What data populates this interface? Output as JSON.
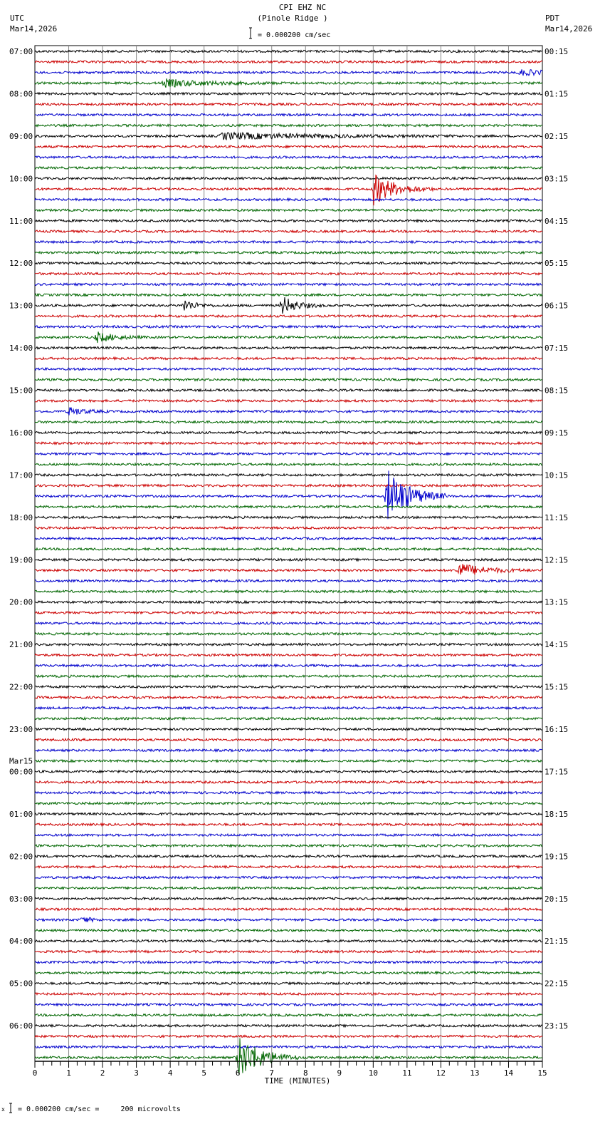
{
  "header": {
    "title": "CPI EHZ NC",
    "subtitle": "(Pinole Ridge )",
    "scale": "= 0.000200 cm/sec",
    "left_tz": "UTC",
    "left_date": "Mar14,2026",
    "right_tz": "PDT",
    "right_date": "Mar14,2026"
  },
  "footer": {
    "scale": "= 0.000200 cm/sec =     200 microvolts"
  },
  "chart_data": {
    "type": "line",
    "title": "CPI EHZ NC (Pinole Ridge )",
    "xlabel": "TIME (MINUTES)",
    "xlim": [
      0,
      15
    ],
    "xticks": [
      "0",
      "1",
      "2",
      "3",
      "4",
      "5",
      "6",
      "7",
      "8",
      "9",
      "10",
      "11",
      "12",
      "13",
      "14",
      "15"
    ],
    "traces_per_hour": 4,
    "trace_colors": [
      "#000000",
      "#cc0000",
      "#0000cc",
      "#006600"
    ],
    "left_labels": [
      "07:00",
      "08:00",
      "09:00",
      "10:00",
      "11:00",
      "12:00",
      "13:00",
      "14:00",
      "15:00",
      "16:00",
      "17:00",
      "18:00",
      "19:00",
      "20:00",
      "21:00",
      "22:00",
      "23:00",
      "00:00",
      "01:00",
      "02:00",
      "03:00",
      "04:00",
      "05:00",
      "06:00"
    ],
    "date_change": {
      "hour_index": 17,
      "label": "Mar15"
    },
    "right_labels": [
      "00:15",
      "01:15",
      "02:15",
      "03:15",
      "04:15",
      "05:15",
      "06:15",
      "07:15",
      "08:15",
      "09:15",
      "10:15",
      "11:15",
      "12:15",
      "13:15",
      "14:15",
      "15:15",
      "16:15",
      "17:15",
      "18:15",
      "19:15",
      "20:15",
      "21:15",
      "22:15",
      "23:15"
    ],
    "events": [
      {
        "trace": 3,
        "minute": 3.8,
        "amp": 0.35,
        "dur": 1.2
      },
      {
        "trace": 2,
        "minute": 14.3,
        "amp": 0.25,
        "dur": 1.0
      },
      {
        "trace": 8,
        "minute": 5.5,
        "amp": 0.3,
        "dur": 2.5
      },
      {
        "trace": 13,
        "minute": 10.0,
        "amp": 1.5,
        "dur": 0.6
      },
      {
        "trace": 24,
        "minute": 4.4,
        "amp": 0.6,
        "dur": 0.3
      },
      {
        "trace": 24,
        "minute": 7.3,
        "amp": 0.9,
        "dur": 0.4
      },
      {
        "trace": 27,
        "minute": 1.8,
        "amp": 0.5,
        "dur": 0.5
      },
      {
        "trace": 34,
        "minute": 1.0,
        "amp": 0.4,
        "dur": 0.4
      },
      {
        "trace": 42,
        "minute": 10.4,
        "amp": 2.6,
        "dur": 0.6
      },
      {
        "trace": 49,
        "minute": 12.5,
        "amp": 0.7,
        "dur": 0.7
      },
      {
        "trace": 82,
        "minute": 1.4,
        "amp": 0.35,
        "dur": 0.2
      },
      {
        "trace": 95,
        "minute": 6.0,
        "amp": 2.2,
        "dur": 0.6
      }
    ]
  }
}
